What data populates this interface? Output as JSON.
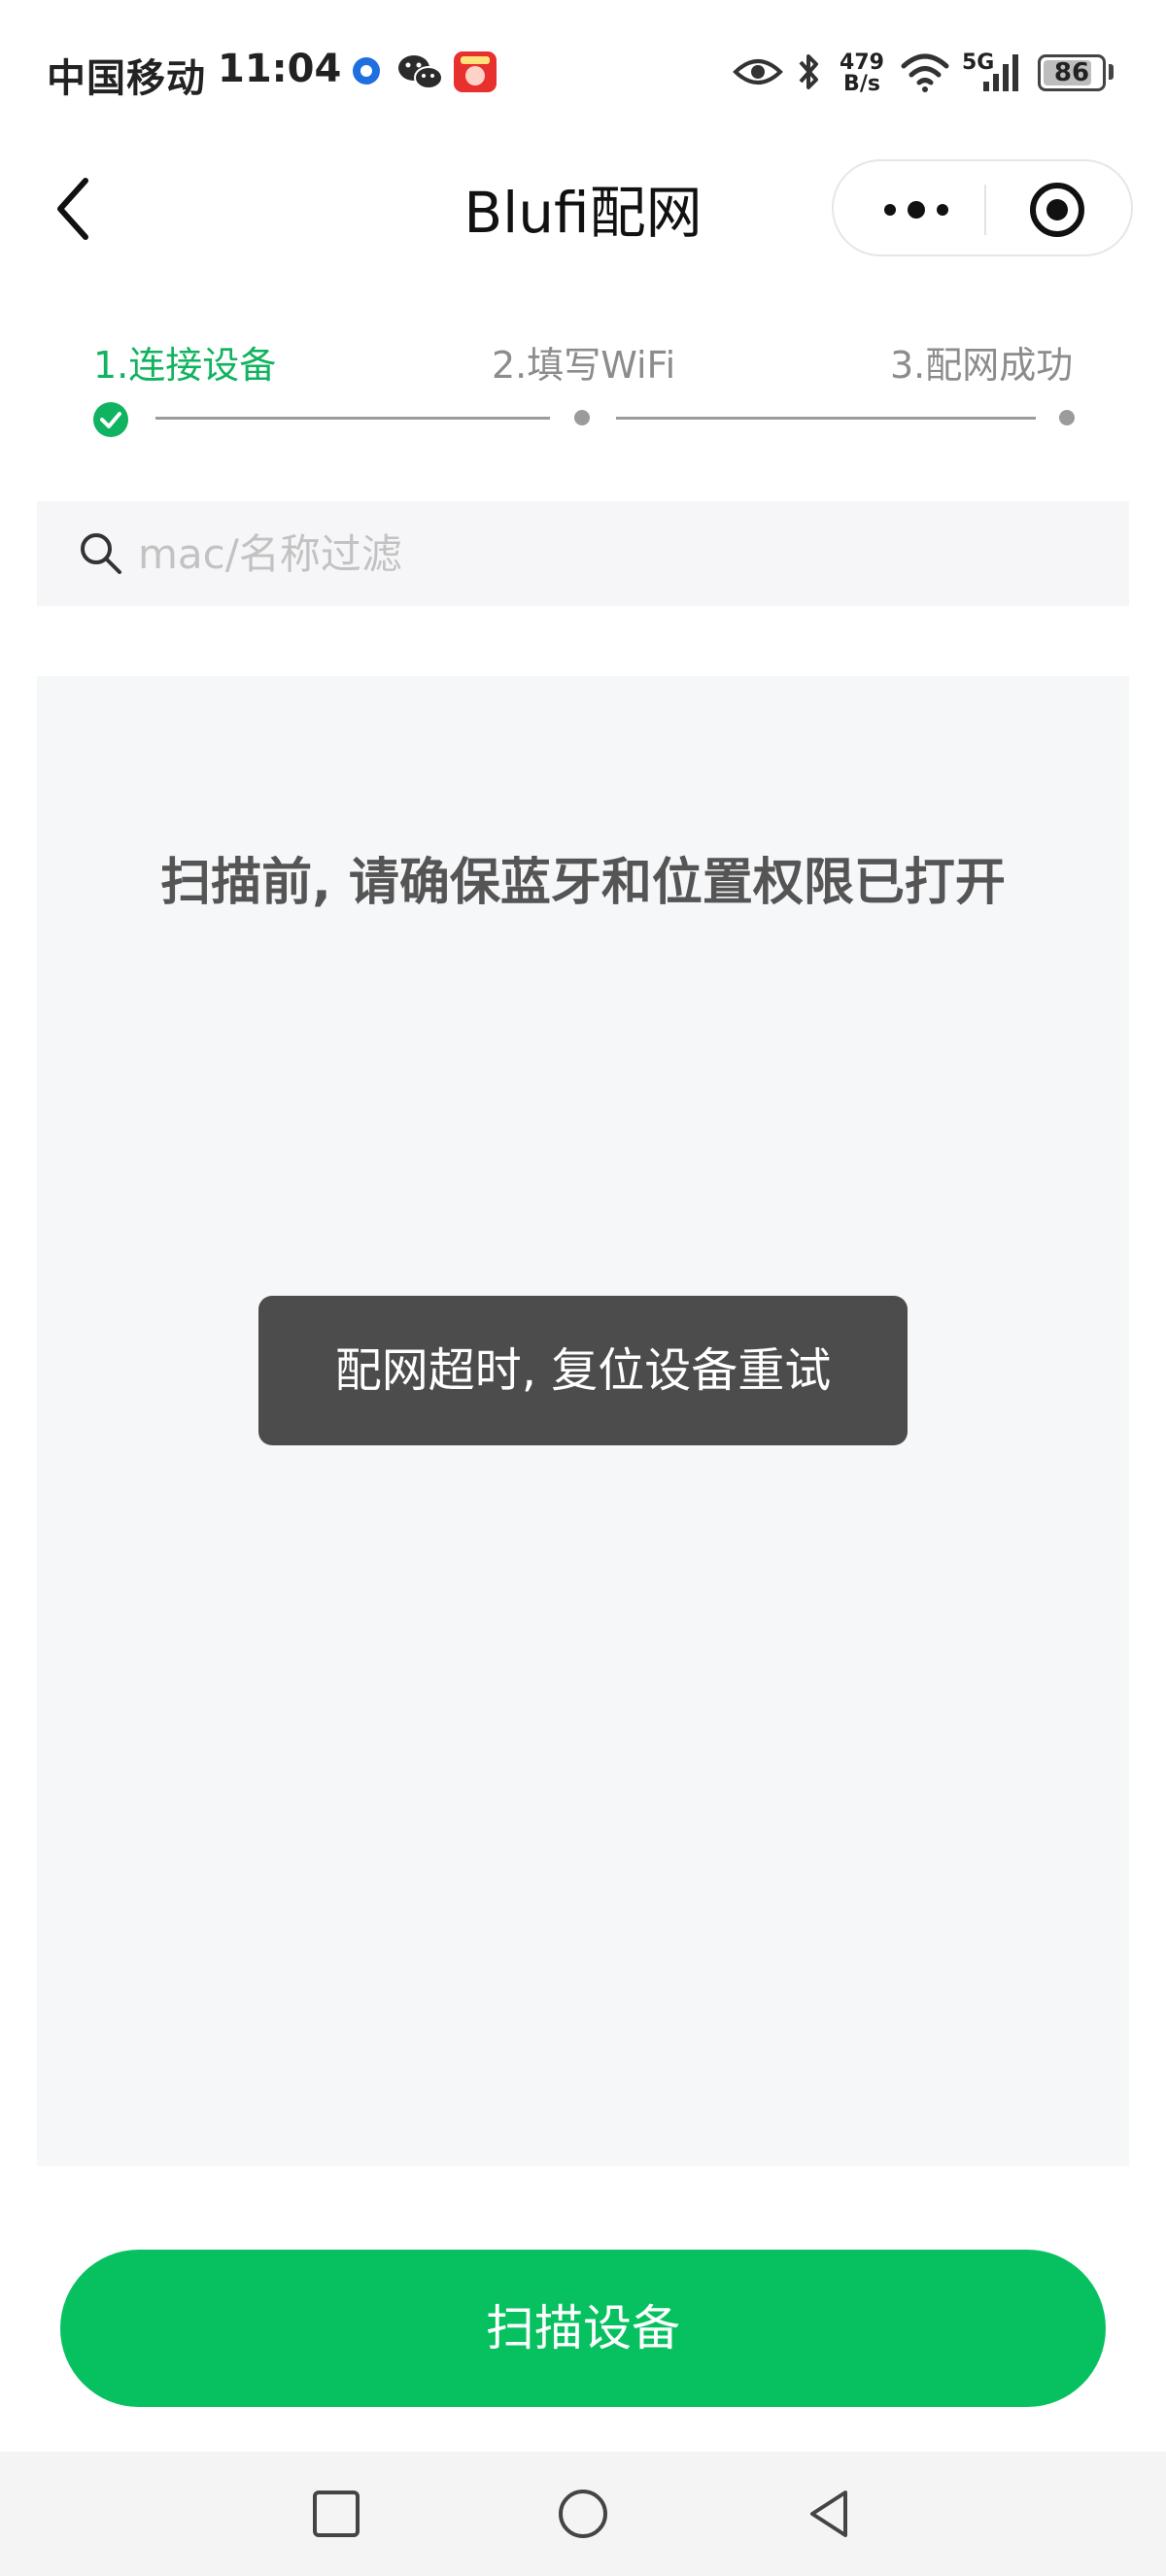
{
  "status_bar": {
    "carrier": "中国移动",
    "time": "11:04",
    "net_speed_value": "479",
    "net_speed_unit": "B/s",
    "network_type": "5G",
    "battery_level": "86",
    "battery_fraction": 0.86
  },
  "nav": {
    "title": "Blufi配网"
  },
  "steps": [
    {
      "label": "1.连接设备",
      "state": "done"
    },
    {
      "label": "2.填写WiFi",
      "state": "pending"
    },
    {
      "label": "3.配网成功",
      "state": "pending"
    }
  ],
  "search": {
    "placeholder": "mac/名称过滤",
    "value": ""
  },
  "list": {
    "hint": "扫描前, 请确保蓝牙和位置权限已打开"
  },
  "toast": {
    "message": "配网超时, 复位设备重试"
  },
  "scan_button": {
    "label": "扫描设备"
  },
  "colors": {
    "accent": "#07c160",
    "step_active": "#10b35f",
    "toast_bg": "#4c4c4c"
  },
  "icons": [
    "app-notify-icon",
    "wechat-icon",
    "app-badge-icon",
    "eye-icon",
    "bluetooth-icon",
    "wifi-icon",
    "signal-icon",
    "battery-icon",
    "back-arrow-icon",
    "more-dots-icon",
    "close-target-icon",
    "check-icon",
    "search-icon",
    "square-icon",
    "circle-icon",
    "triangle-back-icon"
  ]
}
